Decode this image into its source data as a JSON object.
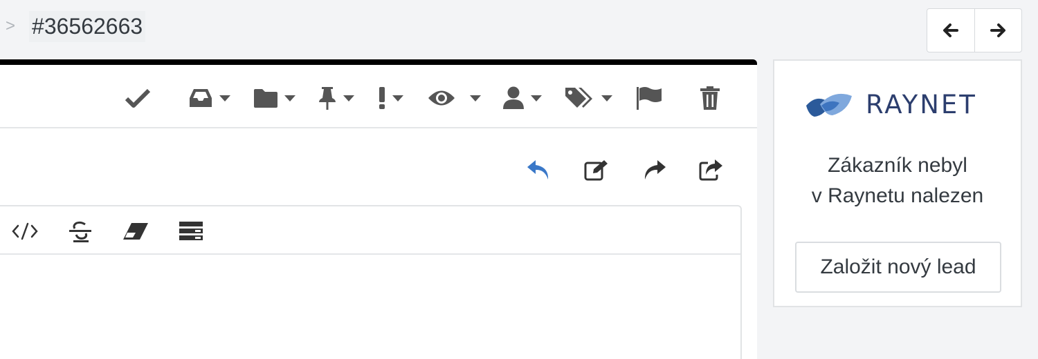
{
  "breadcrumb": {
    "separator": ">",
    "ticket_id": "#36562663"
  },
  "nav": {
    "prev_icon": "arrow-left-icon",
    "next_icon": "arrow-right-icon"
  },
  "toolbar": {
    "icons": [
      "check-icon",
      "inbox-icon",
      "folder-icon",
      "pin-icon",
      "priority-icon",
      "eye-icon",
      "user-icon",
      "tags-icon",
      "flag-icon",
      "trash-icon"
    ]
  },
  "reply_actions": {
    "icons": [
      "reply-icon",
      "edit-icon",
      "forward-icon",
      "share-icon"
    ],
    "accent": "#3a78c8"
  },
  "editor": {
    "icons": [
      "code-icon",
      "strikethrough-icon",
      "eraser-icon",
      "table-icon"
    ]
  },
  "raynet": {
    "logo_text": "RAYNET",
    "message_line1": "Zákazník nebyl",
    "message_line2": "v Raynetu nalezen",
    "create_lead_label": "Založit nový lead",
    "brand_color": "#2c3e6e"
  }
}
